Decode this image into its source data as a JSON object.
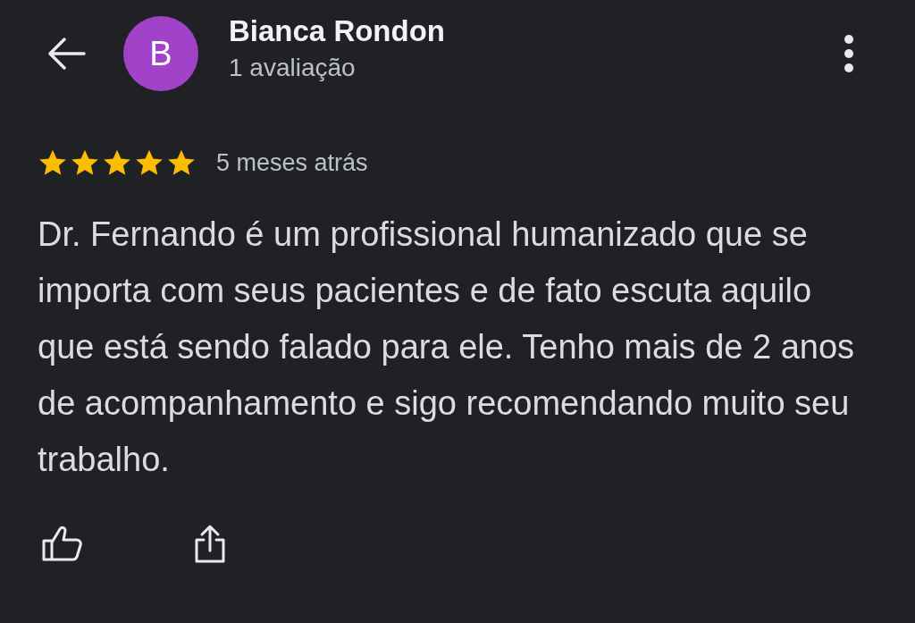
{
  "reviewer": {
    "avatar_letter": "B",
    "name": "Bianca Rondon",
    "review_count": "1 avaliação"
  },
  "review": {
    "stars": 5,
    "time": "5 meses atrás",
    "text": "Dr. Fernando é um profissional humanizado que se importa com seus pacientes e de fato escuta aquilo que está sendo falado para ele. Tenho mais de 2 anos de acompanhamento e sigo recomendando muito seu trabalho."
  }
}
